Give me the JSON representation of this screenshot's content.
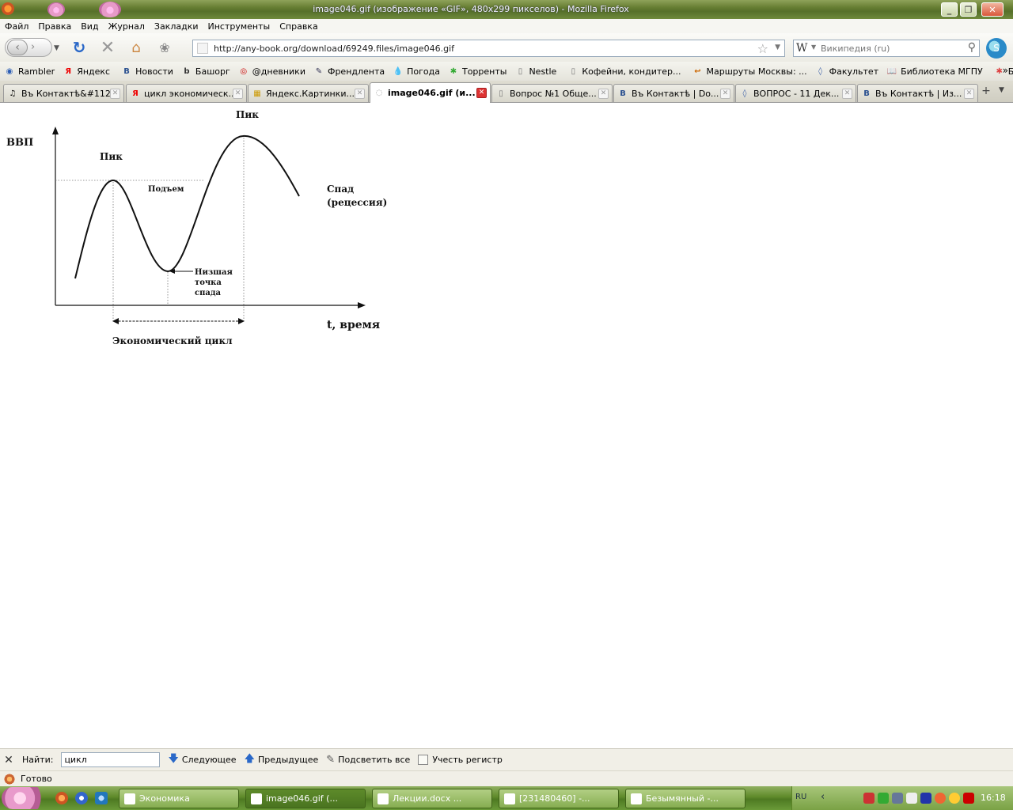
{
  "window": {
    "title": "image046.gif (изображение «GIF», 480x299 пикселов) - Mozilla Firefox",
    "minimize": "_",
    "maximize": "❐",
    "close": "✕"
  },
  "menu": [
    "Файл",
    "Правка",
    "Вид",
    "Журнал",
    "Закладки",
    "Инструменты",
    "Справка"
  ],
  "nav": {
    "url": "http://any-book.org/download/69249.files/image046.gif",
    "search_placeholder": "Википедия (ru)",
    "search_engine_icon": "W"
  },
  "bookmarks": [
    {
      "label": "Rambler",
      "icon": "rambler-icon",
      "glyph": "◉",
      "color": "#2b5db5"
    },
    {
      "label": "Яндекс",
      "icon": "yandex-icon",
      "glyph": "Я",
      "color": "#e00"
    },
    {
      "label": "Новости",
      "icon": "vk-icon",
      "glyph": "В",
      "color": "#2b5190"
    },
    {
      "label": "Башорг",
      "icon": "bash-icon",
      "glyph": "b",
      "color": "#333"
    },
    {
      "label": "@дневники",
      "icon": "diary-icon",
      "glyph": "◎",
      "color": "#c00"
    },
    {
      "label": "Френдлента",
      "icon": "pencil-icon",
      "glyph": "✎",
      "color": "#335"
    },
    {
      "label": "Погода",
      "icon": "drop-icon",
      "glyph": "💧",
      "color": "#27a"
    },
    {
      "label": "Торренты",
      "icon": "torrent-icon",
      "glyph": "✱",
      "color": "#3a3"
    },
    {
      "label": "Nestle",
      "icon": "page-icon",
      "glyph": "▯",
      "color": "#777"
    },
    {
      "label": "Кофейни, кондитер...",
      "icon": "page-icon",
      "glyph": "▯",
      "color": "#777"
    },
    {
      "label": "Маршруты Москвы: ...",
      "icon": "route-icon",
      "glyph": "↩",
      "color": "#c60"
    },
    {
      "label": "Факультет",
      "icon": "faculty-icon",
      "glyph": "◊",
      "color": "#46a"
    },
    {
      "label": "Библиотека МГПУ",
      "icon": "book-icon",
      "glyph": "📖",
      "color": "#333"
    },
    {
      "label": "БТ-Дневник",
      "icon": "bt-icon",
      "glyph": "✱",
      "color": "#d44"
    }
  ],
  "tabs": [
    {
      "label": "Въ Контактѣ&#112...",
      "icon": "music-icon",
      "glyph": "♫",
      "color": "#000",
      "active": false
    },
    {
      "label": "цикл экономическ...",
      "icon": "yandex-icon",
      "glyph": "Я",
      "color": "#e00",
      "active": false
    },
    {
      "label": "Яндекс.Картинки...",
      "icon": "images-icon",
      "glyph": "▦",
      "color": "#c90",
      "active": false
    },
    {
      "label": "image046.gif (и...",
      "icon": "image-icon",
      "glyph": "◌",
      "color": "#999",
      "active": true
    },
    {
      "label": "Вопрос №1 Обще...",
      "icon": "page-icon",
      "glyph": "▯",
      "color": "#777",
      "active": false
    },
    {
      "label": "Въ Контактѣ | Do...",
      "icon": "vk-icon",
      "glyph": "В",
      "color": "#2b5190",
      "active": false
    },
    {
      "label": "ВОПРОС - 11 Дек...",
      "icon": "faculty-icon",
      "glyph": "◊",
      "color": "#46a",
      "active": false
    },
    {
      "label": "Въ Контактѣ | Из...",
      "icon": "vk-icon",
      "glyph": "В",
      "color": "#2b5190",
      "active": false
    }
  ],
  "figure": {
    "ylabel": "ВВП",
    "xlabel": "t, время",
    "peak1": "Пик",
    "peak2": "Пик",
    "rise": "Подъем",
    "decline_1": "Спад",
    "decline_2": "(рецессия)",
    "trough_1": "Низшая",
    "trough_2": "точка",
    "trough_3": "спада",
    "cycle": "Экономический цикл"
  },
  "findbar": {
    "label": "Найти:",
    "value": "цикл",
    "next": "Следующее",
    "prev": "Предыдущее",
    "highlight": "Подсветить все",
    "match_case": "Учесть регистр"
  },
  "status": {
    "text": "Готово"
  },
  "taskbar": {
    "tasks": [
      {
        "label": "Экономика",
        "active": false
      },
      {
        "label": "image046.gif (...",
        "active": true
      },
      {
        "label": "Лекции.docx ...",
        "active": false
      },
      {
        "label": "[231480460] -...",
        "active": false
      },
      {
        "label": "Безымянный -...",
        "active": false
      }
    ],
    "lang": "RU",
    "clock": "16:18"
  }
}
